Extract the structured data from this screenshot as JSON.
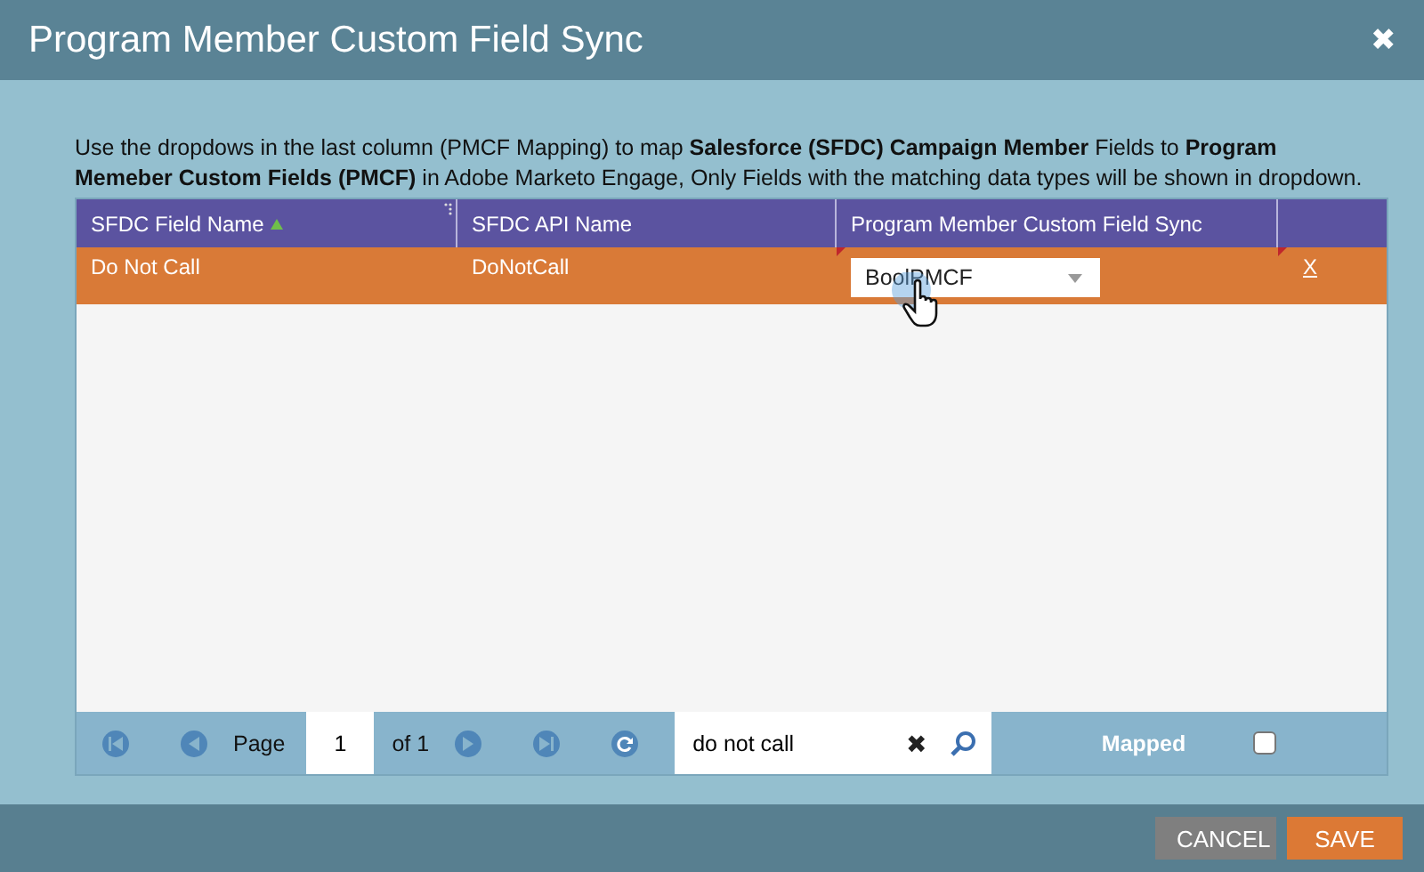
{
  "window": {
    "title": "Program Member Custom Field Sync",
    "close": "✖"
  },
  "intro": "Use the dropdows in the last column (PMCF Mapping) to map **Salesforce (SFDC) Campaign Member** Fields to **Program Memeber Custom Fields (PMCF)** in Adobe Marketo Engage, Only Fields with the matching data types will be shown in dropdown.",
  "table": {
    "columns": [
      {
        "label": "SFDC Field Name",
        "sorted": true
      },
      {
        "label": "SFDC API Name",
        "sorted": false
      },
      {
        "label": "Program Member Custom Field Sync",
        "sorted": false
      },
      {
        "sorted": false
      }
    ],
    "rows": [
      {
        "field_name": "Do Not Call",
        "api_name": "DoNotCall",
        "mapping": "BoolPMCF",
        "remove": "X",
        "selected": true
      }
    ]
  },
  "pager": {
    "page_label": "Page",
    "page": "1",
    "of": "of 1",
    "search": "do not call",
    "clear": "✖",
    "mapped_label": "Mapped",
    "mapped_checked": false
  },
  "buttons": [
    {
      "label": "CANCEL",
      "kind": "secondary"
    },
    {
      "label": "SAVE",
      "kind": "primary"
    }
  ]
}
